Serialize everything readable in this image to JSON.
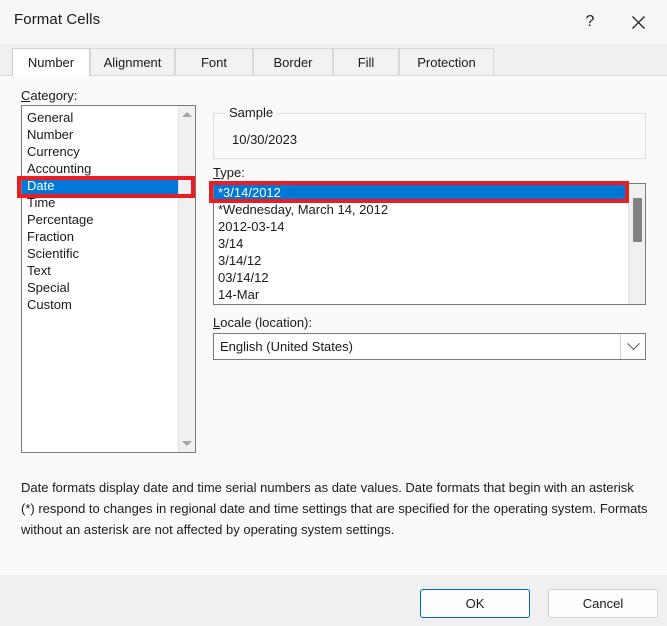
{
  "window": {
    "title": "Format Cells",
    "help_icon": "question-mark-icon",
    "close_icon": "close-icon"
  },
  "tabs": [
    {
      "label": "Number",
      "active": true
    },
    {
      "label": "Alignment",
      "active": false
    },
    {
      "label": "Font",
      "active": false
    },
    {
      "label": "Border",
      "active": false
    },
    {
      "label": "Fill",
      "active": false
    },
    {
      "label": "Protection",
      "active": false
    }
  ],
  "category": {
    "label_accel": "C",
    "label_rest": "ategory:",
    "items": [
      "General",
      "Number",
      "Currency",
      "Accounting",
      "Date",
      "Time",
      "Percentage",
      "Fraction",
      "Scientific",
      "Text",
      "Special",
      "Custom"
    ],
    "selected": "Date",
    "selected_index": 4
  },
  "sample": {
    "legend": "Sample",
    "value": "10/30/2023"
  },
  "type": {
    "label_accel": "T",
    "label_rest": "ype:",
    "items": [
      "*3/14/2012",
      "*Wednesday, March 14, 2012",
      "2012-03-14",
      "3/14",
      "3/14/12",
      "03/14/12",
      "14-Mar"
    ],
    "selected": "*3/14/2012",
    "selected_index": 0
  },
  "locale": {
    "label_accel": "L",
    "label_rest": "ocale (location):",
    "value": "English (United States)",
    "arrow_icon": "chevron-down-icon"
  },
  "description": "Date formats display date and time serial numbers as date values.  Date formats that begin with an asterisk (*) respond to changes in regional date and time settings that are specified for the operating system. Formats without an asterisk are not affected by operating system settings.",
  "footer": {
    "ok_label": "OK",
    "cancel_label": "Cancel"
  },
  "annotations": {
    "accent_color": "#ec1c24",
    "highlight_color": "#0078d7"
  }
}
